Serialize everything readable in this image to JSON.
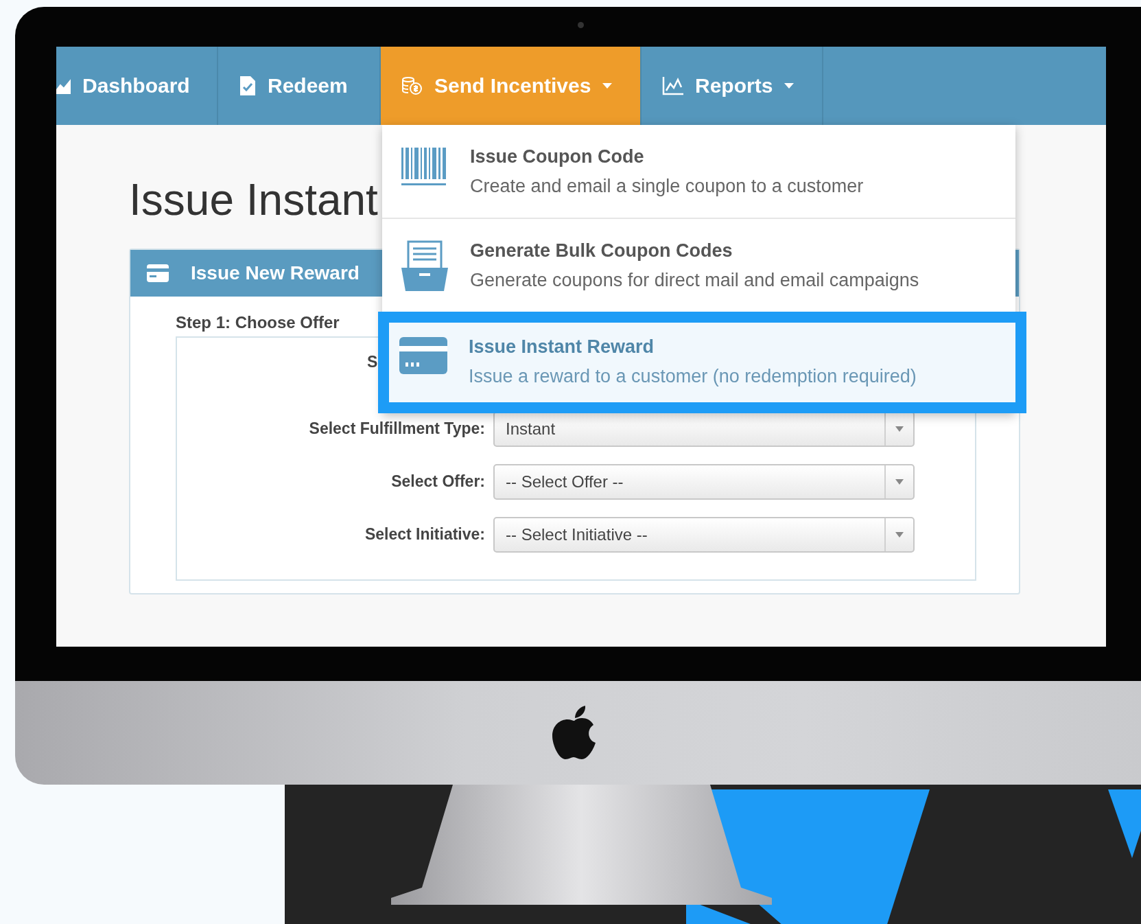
{
  "nav": {
    "items": [
      {
        "label": "Dashboard",
        "dropdown": false,
        "selected": false
      },
      {
        "label": "Redeem",
        "dropdown": false,
        "selected": false
      },
      {
        "label": "Send Incentives",
        "dropdown": true,
        "selected": true
      },
      {
        "label": "Reports",
        "dropdown": true,
        "selected": false
      }
    ]
  },
  "menu": {
    "items": [
      {
        "title": "Issue Coupon Code",
        "description": "Create and email a single coupon to a customer",
        "selected": false
      },
      {
        "title": "Generate Bulk Coupon Codes",
        "description": "Generate coupons for direct mail and email campaigns",
        "selected": false
      },
      {
        "title": "Issue Instant Reward",
        "description": "Issue a reward to a customer (no redemption required)",
        "selected": true
      }
    ]
  },
  "page": {
    "title": "Issue Instant"
  },
  "panel": {
    "title": "Issue New Reward",
    "step": "Step 1: Choose Offer",
    "fields": [
      {
        "kind": "label-only",
        "label": "S"
      },
      {
        "kind": "select",
        "label": "Select Fulfillment Type:",
        "value": "Instant"
      },
      {
        "kind": "select",
        "label": "Select Offer:",
        "value": "-- Select Offer --"
      },
      {
        "kind": "select",
        "label": "Select Initiative:",
        "value": "-- Select Initiative --"
      }
    ]
  }
}
